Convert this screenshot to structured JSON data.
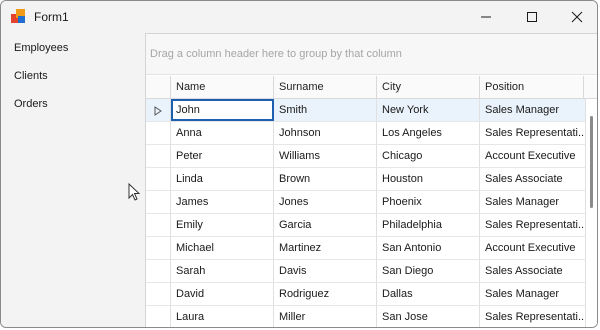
{
  "window": {
    "title": "Form1",
    "icon": "app-icon",
    "controls": [
      "minimize-icon",
      "maximize-icon",
      "close-icon"
    ]
  },
  "nav": {
    "items": [
      {
        "label": "Employees"
      },
      {
        "label": "Clients"
      },
      {
        "label": "Orders"
      }
    ]
  },
  "grid": {
    "group_panel_text": "Drag a column header here to group by that column",
    "columns": [
      "Name",
      "Surname",
      "City",
      "Position"
    ],
    "focused_row": 0,
    "rows": [
      [
        "John",
        "Smith",
        "New York",
        "Sales Manager"
      ],
      [
        "Anna",
        "Johnson",
        "Los Angeles",
        "Sales Representati..."
      ],
      [
        "Peter",
        "Williams",
        "Chicago",
        "Account Executive"
      ],
      [
        "Linda",
        "Brown",
        "Houston",
        "Sales Associate"
      ],
      [
        "James",
        "Jones",
        "Phoenix",
        "Sales Manager"
      ],
      [
        "Emily",
        "Garcia",
        "Philadelphia",
        "Sales Representati..."
      ],
      [
        "Michael",
        "Martinez",
        "San Antonio",
        "Account Executive"
      ],
      [
        "Sarah",
        "Davis",
        "San Diego",
        "Sales Associate"
      ],
      [
        "David",
        "Rodriguez",
        "Dallas",
        "Sales Manager"
      ],
      [
        "Laura",
        "Miller",
        "San Jose",
        "Sales Representati..."
      ]
    ]
  }
}
